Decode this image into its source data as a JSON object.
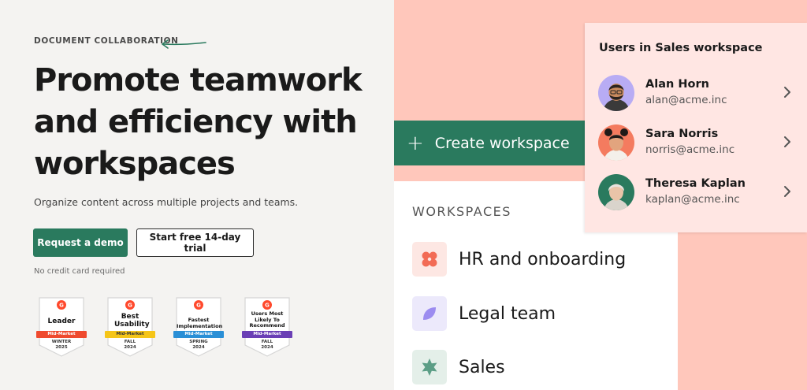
{
  "hero": {
    "eyebrow": "DOCUMENT COLLABORATION",
    "headline_lines": [
      "Promote teamwork",
      "and efficiency with",
      "workspaces"
    ],
    "subtitle": "Organize content across multiple projects and teams.",
    "primary_cta": "Request a demo",
    "secondary_cta": "Start free 14-day trial",
    "note": "No credit card required"
  },
  "badges": [
    {
      "title": "Leader",
      "ribbon": "Mid-Market",
      "season_line1": "WINTER",
      "season_line2": "2025",
      "ribbon_color": "#ef4a2e"
    },
    {
      "title": "Best Usability",
      "ribbon": "Mid-Market",
      "season_line1": "FALL",
      "season_line2": "2024",
      "ribbon_color": "#f5c518"
    },
    {
      "title": "Fastest Implementation",
      "ribbon": "Mid-Market",
      "season_line1": "SPRING",
      "season_line2": "2024",
      "ribbon_color": "#2a8fd6"
    },
    {
      "title": "Users Most Likely To Recommend",
      "ribbon": "Mid-Market",
      "season_line1": "FALL",
      "season_line2": "2024",
      "ribbon_color": "#6a3fb5"
    }
  ],
  "create_button": {
    "label": "Create workspace"
  },
  "workspaces": {
    "header": "WORKSPACES",
    "items": [
      {
        "label": "HR and onboarding",
        "icon": "flower-icon",
        "bg": "#fde7e3",
        "color": "#f26b55"
      },
      {
        "label": "Legal team",
        "icon": "leaf-icon",
        "bg": "#ece9fb",
        "color": "#9c8cf0"
      },
      {
        "label": "Sales",
        "icon": "star-icon",
        "bg": "#e4efe9",
        "color": "#5c9e86"
      }
    ]
  },
  "users": {
    "title": "Users in Sales workspace",
    "items": [
      {
        "name": "Alan Horn",
        "email": "alan@acme.inc",
        "avatar_bg": "#b8acf4"
      },
      {
        "name": "Sara Norris",
        "email": "norris@acme.inc",
        "avatar_bg": "#f47b5f"
      },
      {
        "name": "Theresa Kaplan",
        "email": "kaplan@acme.inc",
        "avatar_bg": "#2a7a5e"
      }
    ]
  },
  "colors": {
    "accent_green": "#2a7a5e",
    "salmon": "#ffc7bb",
    "users_panel": "#ffe6e3"
  }
}
